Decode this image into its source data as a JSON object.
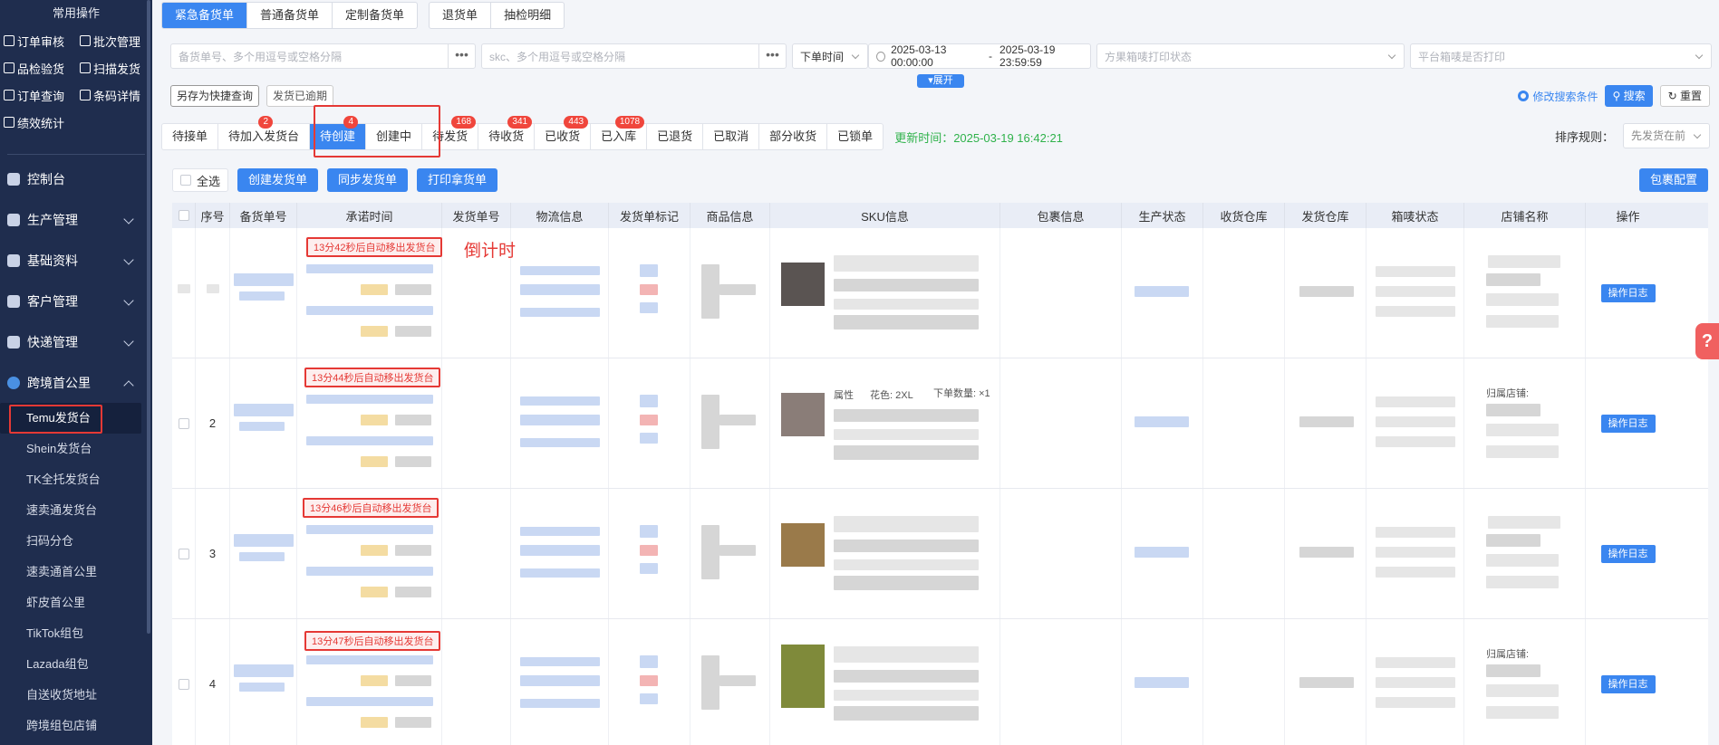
{
  "sidebar": {
    "title": "常用操作",
    "quick": [
      {
        "label": "订单审核",
        "icon": "order-audit-icon"
      },
      {
        "label": "批次管理",
        "icon": "batch-icon"
      },
      {
        "label": "品检验货",
        "icon": "inspect-icon"
      },
      {
        "label": "扫描发货",
        "icon": "scan-ship-icon"
      },
      {
        "label": "订单查询",
        "icon": "order-query-icon"
      },
      {
        "label": "条码详情",
        "icon": "barcode-icon"
      },
      {
        "label": "绩效统计",
        "icon": "stats-icon"
      }
    ],
    "menus": [
      {
        "label": "控制台",
        "icon": "dashboard-icon"
      },
      {
        "label": "生产管理",
        "icon": "production-icon"
      },
      {
        "label": "基础资料",
        "icon": "data-icon"
      },
      {
        "label": "客户管理",
        "icon": "customer-icon"
      },
      {
        "label": "快递管理",
        "icon": "express-icon"
      },
      {
        "label": "跨境首公里",
        "icon": "globe-icon"
      }
    ],
    "submenu": [
      "Temu发货台",
      "Shein发货台",
      "TK全托发货台",
      "速卖通发货台",
      "扫码分仓",
      "速卖通首公里",
      "虾皮首公里",
      "TikTok组包",
      "Lazada组包",
      "自送收货地址",
      "跨境组包店铺"
    ]
  },
  "tabs": {
    "group1": [
      "紧急备货单",
      "普通备货单",
      "定制备货单"
    ],
    "group2": [
      "退货单",
      "抽检明细"
    ]
  },
  "search": {
    "order_placeholder": "备货单号、多个用逗号或空格分隔",
    "skc_placeholder": "skc、多个用逗号或空格分隔",
    "time_type": "下单时间",
    "date_start": "2025-03-13 00:00:00",
    "date_sep": "-",
    "date_end": "2025-03-19 23:59:59",
    "print_status_placeholder": "方果箱唛打印状态",
    "platform_print_placeholder": "平台箱唛是否打印",
    "dots": "•••",
    "expand": "▾展开",
    "save_quick": "另存为快捷查询",
    "overdue": "发货已逾期",
    "edit_conditions": "修改搜索条件",
    "search_btn": "搜索",
    "reset_btn": "重置"
  },
  "status_tabs": [
    {
      "label": "待接单",
      "badge": ""
    },
    {
      "label": "待加入发货台",
      "badge": "2"
    },
    {
      "label": "待创建",
      "badge": "4"
    },
    {
      "label": "创建中",
      "badge": ""
    },
    {
      "label": "待发货",
      "badge": "168"
    },
    {
      "label": "待收货",
      "badge": "341"
    },
    {
      "label": "已收货",
      "badge": "443"
    },
    {
      "label": "已入库",
      "badge": "1078"
    },
    {
      "label": "已退货",
      "badge": ""
    },
    {
      "label": "已取消",
      "badge": ""
    },
    {
      "label": "部分收货",
      "badge": ""
    },
    {
      "label": "已锁单",
      "badge": ""
    }
  ],
  "update_time": "更新时间：2025-03-19 16:42:21",
  "sort": {
    "label": "排序规则：",
    "value": "先发货在前"
  },
  "ops": {
    "select_all": "全选",
    "create": "创建发货单",
    "sync": "同步发货单",
    "print": "打印拿货单",
    "package_config": "包裹配置"
  },
  "table": {
    "headers": [
      "序号",
      "备货单号",
      "承诺时间",
      "发货单号",
      "物流信息",
      "发货单标记",
      "商品信息",
      "SKU信息",
      "包裹信息",
      "生产状态",
      "收货仓库",
      "发货仓库",
      "箱唛状态",
      "店铺名称",
      "操作"
    ],
    "rows": [
      {
        "num": "",
        "countdown": "13分42秒后自动移出发货台",
        "log": "操作日志"
      },
      {
        "num": "2",
        "countdown": "13分44秒后自动移出发货台",
        "log": "操作日志"
      },
      {
        "num": "3",
        "countdown": "13分46秒后自动移出发货台",
        "log": "操作日志"
      },
      {
        "num": "4",
        "countdown": "13分47秒后自动移出发货台",
        "log": "操作日志"
      }
    ],
    "sku_fragments": [
      "属性",
      "花色: 2XL",
      "下单数量: ×1"
    ],
    "shop_fragment": "归属店铺:"
  },
  "annotation": "倒计时",
  "help": "?"
}
